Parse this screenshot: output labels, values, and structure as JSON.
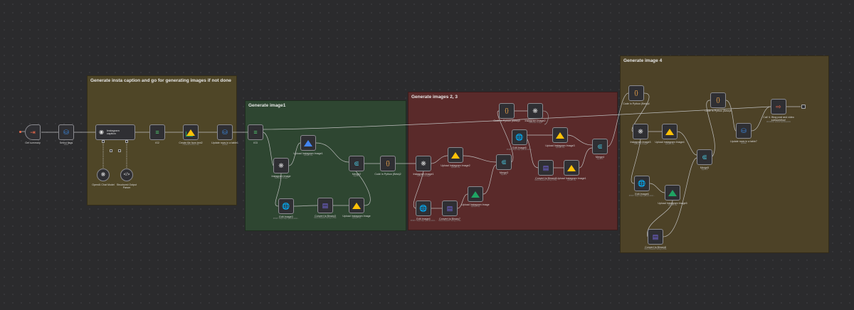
{
  "groups": {
    "g1": "Generate insta caption and go for generating images if not done",
    "g2": "Generate image1",
    "g3": "Generate images 2, 3",
    "g4": "Generate image 4"
  },
  "nodes": {
    "get_summary": {
      "label": "Get summary"
    },
    "select_flags": {
      "label": "Select flags",
      "sub": "select"
    },
    "insta_caption": {
      "label": "Instagram caption"
    },
    "openai_model": {
      "label": "OpenAI Chat Model"
    },
    "structured_parser": {
      "label": "Structured Output Parser"
    },
    "ig2": {
      "label": "IG2"
    },
    "create_file": {
      "label": "Create file from text2",
      "sub": "createFromText: file"
    },
    "update_rows1": {
      "label": "Update rows in a table1",
      "sub": "update"
    },
    "ig3": {
      "label": "IG3"
    },
    "instagram_image": {
      "label": "Instagram Image",
      "sub": "Generate image"
    },
    "upload_img1": {
      "label": "Upload Instagram Image1",
      "sub": "upload: file"
    },
    "edit_image3": {
      "label": "Edit Image3",
      "sub": "POST: https://api.openai.com/..."
    },
    "convert_binary3": {
      "label": "Convert to Binary3",
      "sub": "Move Base64 String to File"
    },
    "upload_img_g2": {
      "label": "Upload Instagram Image",
      "sub": "upload: file"
    },
    "merge2": {
      "label": "Merge2",
      "sub": "append"
    },
    "code_python_ints2": {
      "label": "Code in Python (Beta)2"
    },
    "instagram_image1": {
      "label": "Instagram Image1",
      "sub": "Generate image"
    },
    "upload_img2": {
      "label": "Upload Instagram Image2",
      "sub": "upload: file"
    },
    "edit_image4": {
      "label": "Edit Image4",
      "sub": "POST: https://api.openai.com/..."
    },
    "convert_binary7": {
      "label": "Convert to Binary7",
      "sub": "Move Base64 String to File"
    },
    "upload_img_g3": {
      "label": "Upload Instagram Image",
      "sub": "upload: file"
    },
    "code_python3": {
      "label": "Code in Python (Beta)3"
    },
    "instagram_image2": {
      "label": "Instagram Image2",
      "sub": "Generate image"
    },
    "edit_image5": {
      "label": "Edit Image5",
      "sub": "POST: https://api.openai.com/..."
    },
    "merge3": {
      "label": "Merge3",
      "sub": "append"
    },
    "upload_img3": {
      "label": "Upload Instagram Image3",
      "sub": "upload: file"
    },
    "convert_binary6": {
      "label": "Convert to Binary6",
      "sub": "Move Base64 String to File"
    },
    "upload_img1b": {
      "label": "Upload Instagram Image1",
      "sub": "upload: file"
    },
    "merge4": {
      "label": "Merge4",
      "sub": "append"
    },
    "code_python4": {
      "label": "Code in Python (Beta)4"
    },
    "instagram_image3": {
      "label": "Instagram Image3",
      "sub": "Generate image"
    },
    "upload_img4": {
      "label": "Upload Instagram Image4",
      "sub": "upload: file"
    },
    "edit_image6": {
      "label": "Edit Image6",
      "sub": "POST: https://api.openai.com/..."
    },
    "upload_img5": {
      "label": "Upload Instagram Image5",
      "sub": "upload: file"
    },
    "convert_binary8": {
      "label": "Convert to Binary8",
      "sub": "Move Base64 String to File"
    },
    "merge5": {
      "label": "Merge5",
      "sub": "append"
    },
    "code_python5": {
      "label": "Code in Python (Beta)5"
    },
    "update_rows7": {
      "label": "Update rows in a table7",
      "sub": "update"
    },
    "call_blog": {
      "label": "Call '4. Blog post and video subworkflow'",
      "sub": "Workflow: ambiaYqe02Ipsx3o"
    }
  },
  "icons": {
    "get_summary": "arrow-in-icon",
    "select_flags": "database-icon",
    "code": "braces-icon",
    "openai": "openai-knot-icon",
    "drive": "drive-triangle-icon",
    "merge": "merge-icon",
    "http": "globe-icon",
    "convert": "file-stack-icon",
    "edit_fields": "sliders-icon",
    "parser": "code-tag-icon",
    "execute": "arrow-right-box-icon"
  },
  "colors": {
    "g1": "#4f4627",
    "g2": "#2e4631",
    "g3": "#5a2a2a",
    "g4": "#4d4227",
    "drive_green": "#1fa463",
    "drive_yellow": "#ffc107",
    "drive_blue": "#4285f4",
    "trigger_red": "#ee6a4b",
    "db_blue": "#3c8ce7",
    "edit_green": "#4fc36b",
    "merge_teal": "#47b4c8",
    "code_orange": "#f0a64a",
    "convert_purple": "#7b6be8",
    "http_blue": "#4a8be0"
  }
}
